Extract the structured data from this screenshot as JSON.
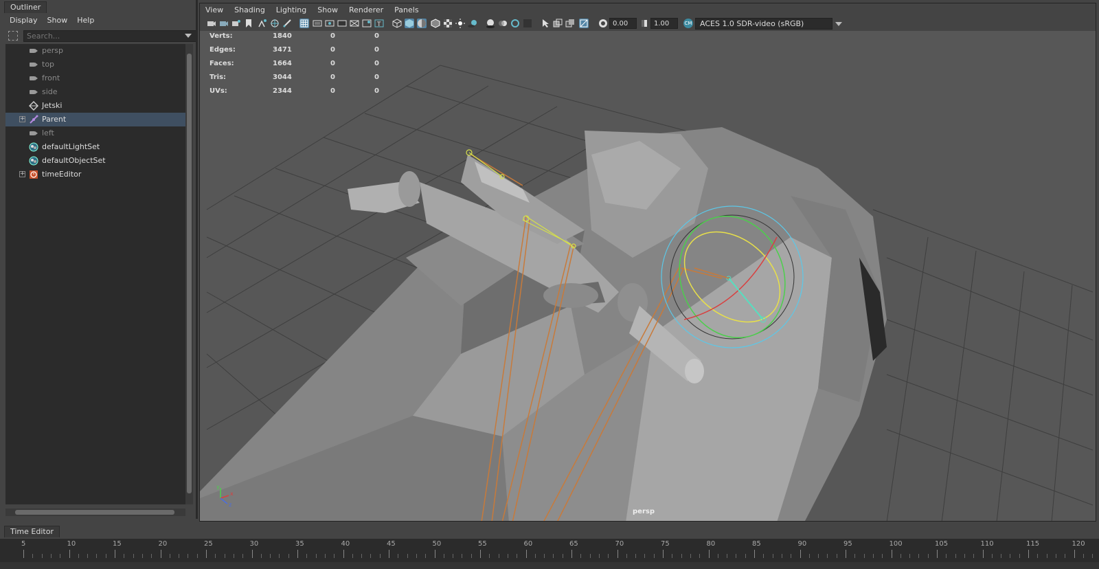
{
  "outliner": {
    "title": "Outliner",
    "menu": [
      "Display",
      "Show",
      "Help"
    ],
    "search_placeholder": "Search...",
    "items": [
      {
        "label": "persp",
        "icon": "camera-icon",
        "dim": true,
        "expandable": false
      },
      {
        "label": "top",
        "icon": "camera-icon",
        "dim": true,
        "expandable": false
      },
      {
        "label": "front",
        "icon": "camera-icon",
        "dim": true,
        "expandable": false
      },
      {
        "label": "side",
        "icon": "camera-icon",
        "dim": true,
        "expandable": false
      },
      {
        "label": "Jetski",
        "icon": "mesh-icon",
        "dim": false,
        "expandable": false
      },
      {
        "label": "Parent",
        "icon": "joint-icon",
        "dim": false,
        "expandable": true,
        "selected": true
      },
      {
        "label": "left",
        "icon": "camera-icon",
        "dim": true,
        "expandable": false
      },
      {
        "label": "defaultLightSet",
        "icon": "set-icon",
        "dim": false,
        "expandable": false
      },
      {
        "label": "defaultObjectSet",
        "icon": "set-icon",
        "dim": false,
        "expandable": false
      },
      {
        "label": "timeEditor",
        "icon": "time-editor-icon",
        "dim": false,
        "expandable": true
      }
    ]
  },
  "viewport": {
    "menu": [
      "View",
      "Shading",
      "Lighting",
      "Show",
      "Renderer",
      "Panels"
    ],
    "exposure": "0.00",
    "gamma": "1.00",
    "color_space_icon_text": "CM",
    "color_space": "ACES 1.0 SDR-video (sRGB)",
    "camera_label": "persp",
    "hud": [
      {
        "label": "Verts:",
        "v1": "1840",
        "v2": "0",
        "v3": "0"
      },
      {
        "label": "Edges:",
        "v1": "3471",
        "v2": "0",
        "v3": "0"
      },
      {
        "label": "Faces:",
        "v1": "1664",
        "v2": "0",
        "v3": "0"
      },
      {
        "label": "Tris:",
        "v1": "3044",
        "v2": "0",
        "v3": "0"
      },
      {
        "label": "UVs:",
        "v1": "2344",
        "v2": "0",
        "v3": "0"
      }
    ],
    "axis_labels": {
      "y": "y",
      "x": "x",
      "z": "z"
    }
  },
  "time_editor": {
    "tab": "Time Editor",
    "ticks": [
      "5",
      "10",
      "15",
      "20",
      "25",
      "30",
      "35",
      "40",
      "45",
      "50",
      "55",
      "60",
      "65",
      "70",
      "75",
      "80",
      "85",
      "90",
      "95",
      "100",
      "105",
      "110",
      "115",
      "120"
    ]
  },
  "colors": {
    "accent": "#5285a6",
    "selected_row": "#3f4f61",
    "rig_orange": "#c87a3a",
    "manip_cyan": "#5cc8e8"
  }
}
